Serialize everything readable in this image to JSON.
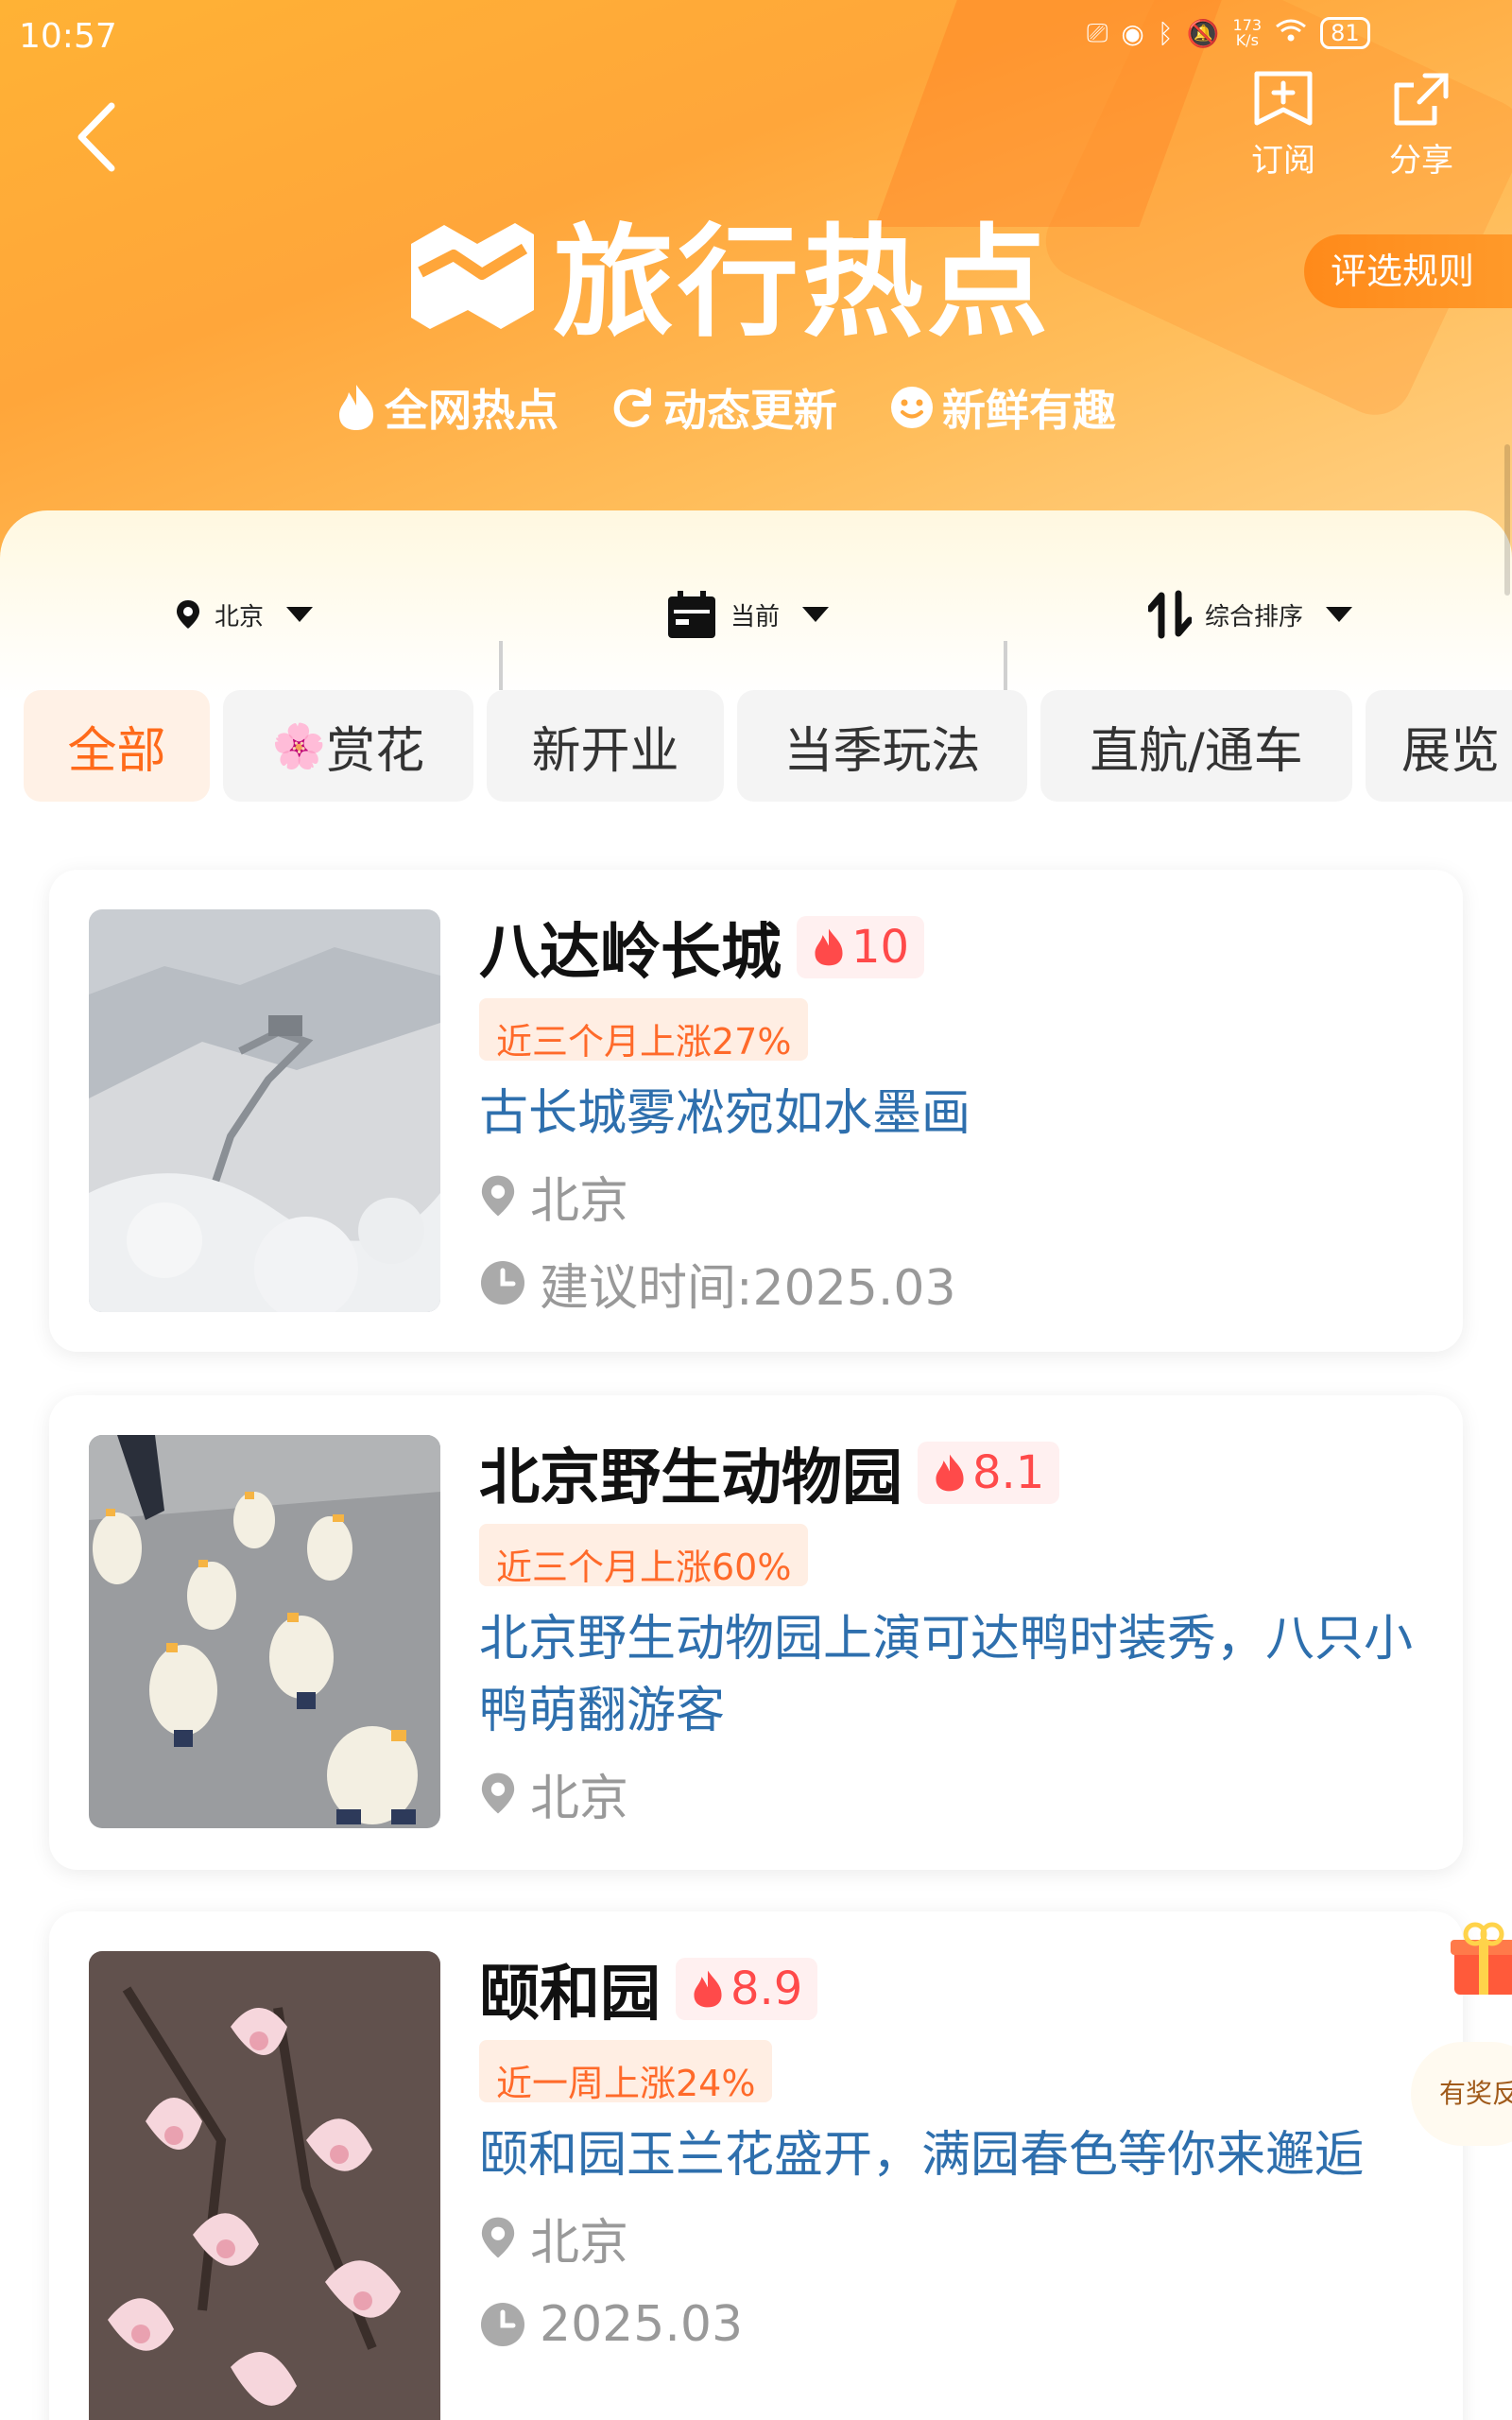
{
  "status_bar": {
    "time": "10:57",
    "net_speed": "173",
    "net_unit": "K/s",
    "battery": "81"
  },
  "header": {
    "title": "旅行热点",
    "subscribe_label": "订阅",
    "share_label": "分享",
    "rules_label": "评选规则",
    "features": [
      {
        "icon": "flame-icon",
        "label": "全网热点"
      },
      {
        "icon": "refresh-icon",
        "label": "动态更新"
      },
      {
        "icon": "smiley-icon",
        "label": "新鲜有趣"
      }
    ]
  },
  "filters": {
    "city": "北京",
    "time": "当前",
    "sort": "综合排序"
  },
  "tabs": [
    {
      "label": "全部",
      "active": true
    },
    {
      "label": "赏花",
      "active": false,
      "emoji": "🌸"
    },
    {
      "label": "新开业",
      "active": false
    },
    {
      "label": "当季玩法",
      "active": false
    },
    {
      "label": "直航/通车",
      "active": false
    },
    {
      "label": "展览",
      "active": false
    }
  ],
  "cards": [
    {
      "name": "八达岭长城",
      "heat": "10",
      "trend": "近三个月上涨27%",
      "desc": "古长城雾凇宛如水墨画",
      "city": "北京",
      "time": "建议时间:2025.03"
    },
    {
      "name": "北京野生动物园",
      "heat": "8.1",
      "trend": "近三个月上涨60%",
      "desc": "北京野生动物园上演可达鸭时装秀，八只小鸭萌翻游客",
      "city": "北京"
    },
    {
      "name": "颐和园",
      "heat": "8.9",
      "trend": "近一周上涨24%",
      "desc": "颐和园玉兰花盛开，满园春色等你来邂逅",
      "city": "北京",
      "time": "2025.03"
    }
  ],
  "floating": {
    "feedback": "有奖反馈"
  },
  "colors": {
    "accent": "#ff6a1a",
    "heat": "#ff4a4a",
    "link": "#2e6fad",
    "hero": "#ffa63a"
  }
}
